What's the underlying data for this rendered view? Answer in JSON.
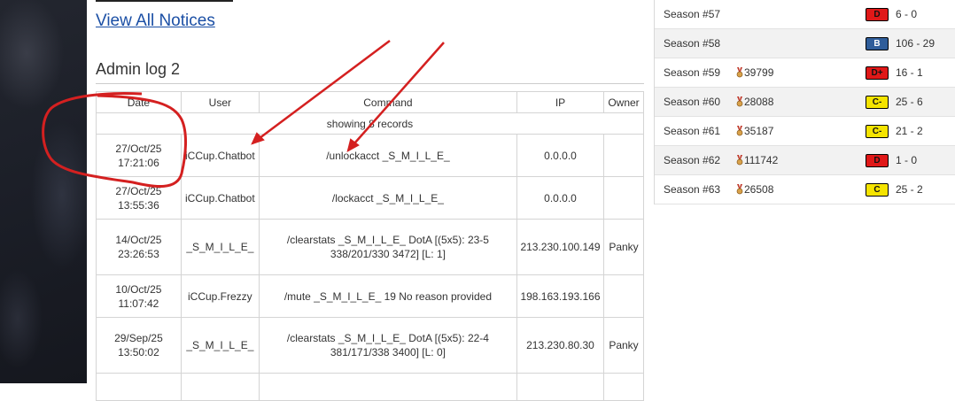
{
  "notices": {
    "view_all": "View All Notices"
  },
  "admin_log": {
    "title": "Admin log 2",
    "headers": [
      "Date",
      "User",
      "Command",
      "IP",
      "Owner"
    ],
    "record_info": "showing 8 records",
    "rows": [
      {
        "date": "27/Oct/25",
        "time": "17:21:06",
        "user": "iCCup.Chatbot",
        "cmd1": "/unlockacct _S_M_I_L_E_",
        "cmd2": "",
        "ip": "0.0.0.0",
        "owner": ""
      },
      {
        "date": "27/Oct/25",
        "time": "13:55:36",
        "user": "iCCup.Chatbot",
        "cmd1": "/lockacct _S_M_I_L_E_",
        "cmd2": "",
        "ip": "0.0.0.0",
        "owner": ""
      },
      {
        "date": "14/Oct/25",
        "time": "23:26:53",
        "user": "_S_M_I_L_E_",
        "cmd1": "/clearstats _S_M_I_L_E_ DotA [(5x5): 23-5",
        "cmd2": "338/201/330 3472] [L: 1]",
        "ip": "213.230.100.149",
        "owner": "Panky"
      },
      {
        "date": "10/Oct/25",
        "time": "11:07:42",
        "user": "iCCup.Frezzy",
        "cmd1": "/mute _S_M_I_L_E_ 19 No reason provided",
        "cmd2": "",
        "ip": "198.163.193.166",
        "owner": ""
      },
      {
        "date": "29/Sep/25",
        "time": "13:50:02",
        "user": "_S_M_I_L_E_",
        "cmd1": "/clearstats _S_M_I_L_E_ DotA [(5x5): 22-4",
        "cmd2": "381/171/338 3400] [L: 0]",
        "ip": "213.230.80.30",
        "owner": "Panky"
      }
    ]
  },
  "seasons": [
    {
      "name": "Season #57",
      "points": "",
      "rank": "D",
      "rank_color": "#e01818",
      "score": "6 - 0"
    },
    {
      "name": "Season #58",
      "points": "",
      "rank": "B",
      "rank_color": "#2f5d9a",
      "score": "106 - 29"
    },
    {
      "name": "Season #59",
      "points": "39799",
      "rank": "D+",
      "rank_color": "#e01818",
      "score": "16 - 1"
    },
    {
      "name": "Season #60",
      "points": "28088",
      "rank": "C-",
      "rank_color": "#f5e400",
      "score": "25 - 6"
    },
    {
      "name": "Season #61",
      "points": "35187",
      "rank": "C-",
      "rank_color": "#f5e400",
      "score": "21 - 2"
    },
    {
      "name": "Season #62",
      "points": "111742",
      "rank": "D",
      "rank_color": "#e01818",
      "score": "1 - 0"
    },
    {
      "name": "Season #63",
      "points": "26508",
      "rank": "C",
      "rank_color": "#f5e400",
      "score": "25 - 2"
    }
  ],
  "annotation_color": "#d42020"
}
